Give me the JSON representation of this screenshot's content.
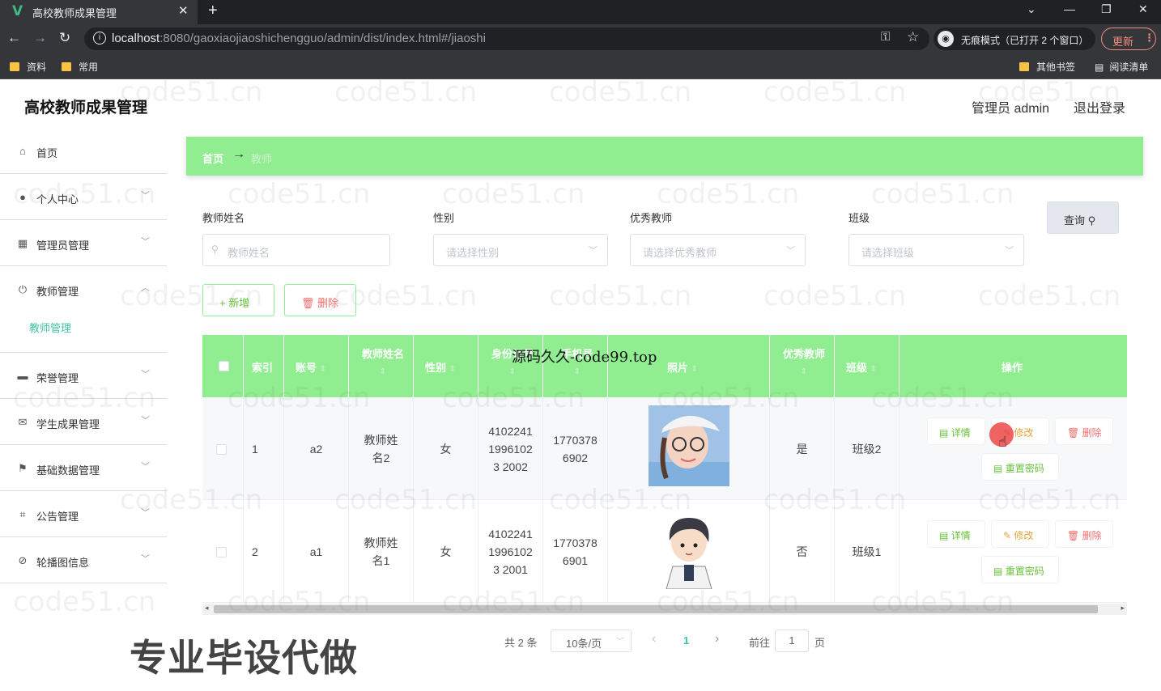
{
  "browser": {
    "tab_title": "高校教师成果管理",
    "tab_logo": "V",
    "tab_close": "✕",
    "new_tab": "+",
    "url_host": "localhost",
    "url_path": ":8080/gaoxiaojiaoshichengguo/admin/dist/index.html#/jiaoshi",
    "incognito_label": "无痕模式（已打开 2 个窗口）",
    "update_label": "更新",
    "bookmarks": [
      "资料",
      "常用"
    ],
    "bookmarks_right": [
      "其他书签",
      "阅读清单"
    ]
  },
  "header": {
    "title": "高校教师成果管理",
    "user": "管理员 admin",
    "logout": "退出登录"
  },
  "sidebar": {
    "items": [
      {
        "label": "首页",
        "icon": "home-icon"
      },
      {
        "label": "个人中心",
        "icon": "user-icon"
      },
      {
        "label": "管理员管理",
        "icon": "grid-icon"
      },
      {
        "label": "教师管理",
        "icon": "power-icon"
      },
      {
        "label": "荣誉管理",
        "icon": "podium-icon"
      },
      {
        "label": "学生成果管理",
        "icon": "mail-icon"
      },
      {
        "label": "基础数据管理",
        "icon": "flag-icon"
      },
      {
        "label": "公告管理",
        "icon": "crop-icon"
      },
      {
        "label": "轮播图信息",
        "icon": "no-image-icon"
      }
    ],
    "sub_item": "教师管理"
  },
  "breadcrumb": {
    "home": "首页",
    "arrow": "→",
    "current": "教师"
  },
  "filters": {
    "name_label": "教师姓名",
    "name_placeholder": "教师姓名",
    "gender_label": "性别",
    "gender_placeholder": "请选择性别",
    "excellent_label": "优秀教师",
    "excellent_placeholder": "请选择优秀教师",
    "class_label": "班级",
    "class_placeholder": "请选择班级",
    "query": "查询"
  },
  "actions": {
    "add": "新增",
    "delete": "删除"
  },
  "table": {
    "headers": {
      "index": "索引",
      "account": "账号",
      "name": "教师姓名",
      "gender": "性别",
      "idcard": "身份证号",
      "phone": "手机号",
      "photo": "照片",
      "excellent": "优秀教师",
      "class": "班级",
      "ops": "操作"
    },
    "rows": [
      {
        "index": "1",
        "account": "a2",
        "name": "教师姓名2",
        "gender": "女",
        "idcard": "410224119961023 2002",
        "phone": "17703786902",
        "excellent": "是",
        "class": "班级2"
      },
      {
        "index": "2",
        "account": "a1",
        "name": "教师姓名1",
        "gender": "女",
        "idcard": "410224119961023 2001",
        "phone": "17703786901",
        "excellent": "否",
        "class": "班级1"
      }
    ],
    "op_labels": {
      "detail": "详情",
      "edit": "修改",
      "delete": "删除",
      "reset": "重置密码"
    }
  },
  "pager": {
    "total": "共 2 条",
    "page_size": "10条/页",
    "prev": "‹",
    "current": "1",
    "next": "›",
    "goto": "前往",
    "goto_value": "1",
    "page_unit": "页"
  },
  "overlays": {
    "watermark": "code51.cn",
    "banner": "源码久久-code99.top",
    "promo": "专业毕设代做"
  }
}
